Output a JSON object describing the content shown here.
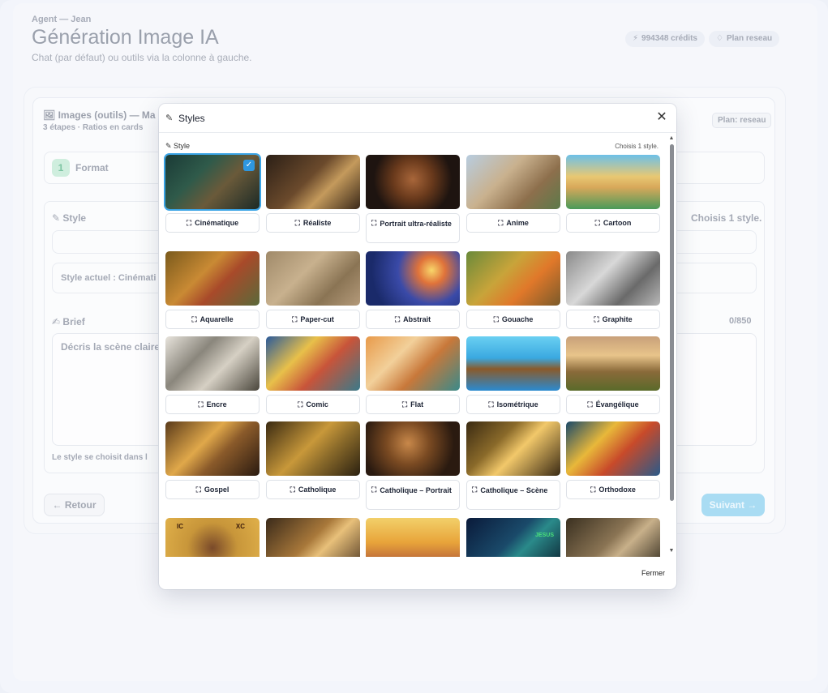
{
  "header": {
    "crumb": "Agent — Jean",
    "title": "Génération Image IA",
    "subtitle": "Chat (par défaut) ou outils via la colonne à gauche.",
    "credits": "994348 crédits",
    "plan": "Plan reseau"
  },
  "background": {
    "card_title": "Images (outils) — Ma",
    "card_subtitle": "3 étapes · Ratios en cards",
    "plan_badge": "Plan: reseau",
    "step_number": "1",
    "step_label": "Format",
    "style_label": "Style",
    "style_hint": "Choisis 1 style.",
    "style_current": "Style actuel : Cinémati",
    "brief_label": "Brief",
    "brief_count": "0/850",
    "brief_placeholder": "Décris la scène claire",
    "style_note": "Le style se choisit dans l",
    "back_label": "Retour",
    "next_label": "Suivant"
  },
  "modal": {
    "title": "Styles",
    "section_label": "Style",
    "section_hint": "Choisis 1 style.",
    "close_label": "Fermer",
    "styles": [
      {
        "label": "Cinématique",
        "selected": true
      },
      {
        "label": "Réaliste",
        "selected": false
      },
      {
        "label": "Portrait ultra-réaliste",
        "selected": false
      },
      {
        "label": "Anime",
        "selected": false
      },
      {
        "label": "Cartoon",
        "selected": false
      },
      {
        "label": "Aquarelle",
        "selected": false
      },
      {
        "label": "Paper-cut",
        "selected": false
      },
      {
        "label": "Abstrait",
        "selected": false
      },
      {
        "label": "Gouache",
        "selected": false
      },
      {
        "label": "Graphite",
        "selected": false
      },
      {
        "label": "Encre",
        "selected": false
      },
      {
        "label": "Comic",
        "selected": false
      },
      {
        "label": "Flat",
        "selected": false
      },
      {
        "label": "Isométrique",
        "selected": false
      },
      {
        "label": "Évangélique",
        "selected": false
      },
      {
        "label": "Gospel",
        "selected": false
      },
      {
        "label": "Catholique",
        "selected": false
      },
      {
        "label": "Catholique – Portrait",
        "selected": false
      },
      {
        "label": "Catholique – Scène",
        "selected": false
      },
      {
        "label": "Orthodoxe",
        "selected": false
      },
      {
        "label": "",
        "selected": false
      },
      {
        "label": "",
        "selected": false
      },
      {
        "label": "",
        "selected": false
      },
      {
        "label": "",
        "selected": false
      },
      {
        "label": "",
        "selected": false
      }
    ],
    "thumbnail_text": {
      "orthodox_left": "IC",
      "orthodox_right": "XC",
      "neon_sign": "JESUS"
    }
  },
  "colors": {
    "accent": "#2e97e0",
    "next_button": "#a9dcf3"
  }
}
